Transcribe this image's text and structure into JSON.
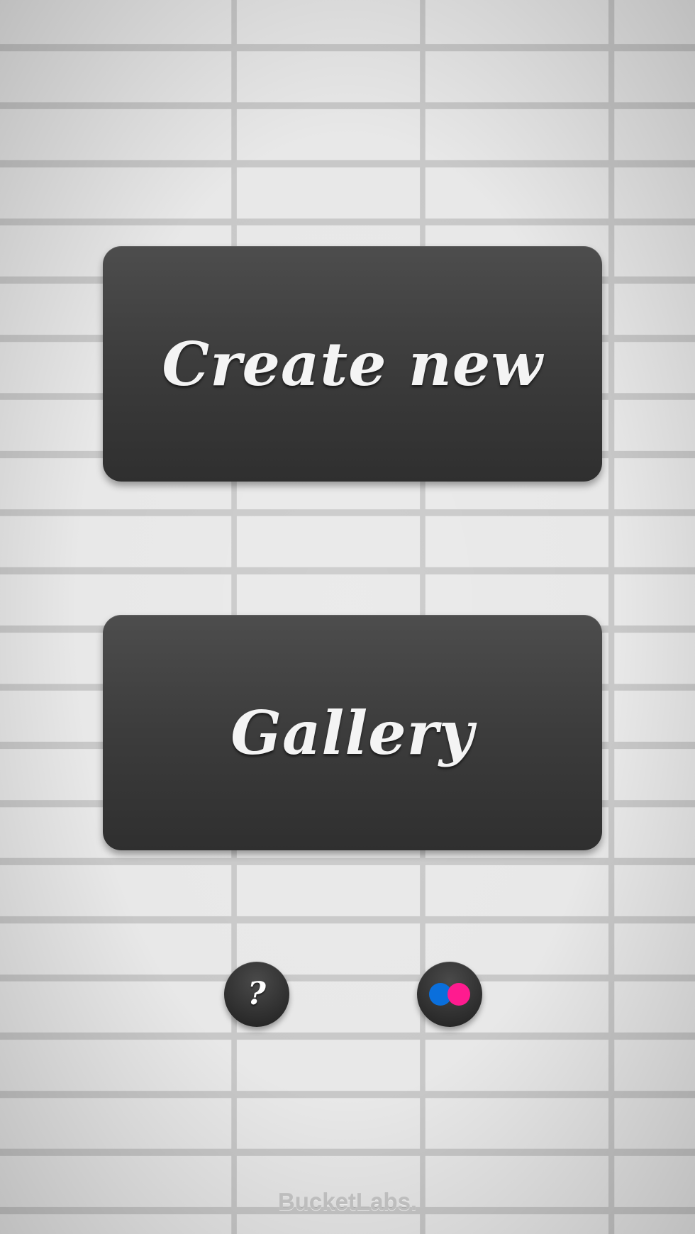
{
  "main": {
    "create_label": "Create new",
    "gallery_label": "Gallery"
  },
  "footer": {
    "help_label": "?",
    "brand": "BucketLabs."
  },
  "icons": {
    "help": "question-mark-icon",
    "flickr": "flickr-icon"
  },
  "colors": {
    "button_bg": "#3c3c3c",
    "button_text": "#f4f4f4",
    "wall": "#e6e6e6",
    "flickr_blue": "#0a6fdc",
    "flickr_pink": "#ff1b8f"
  }
}
